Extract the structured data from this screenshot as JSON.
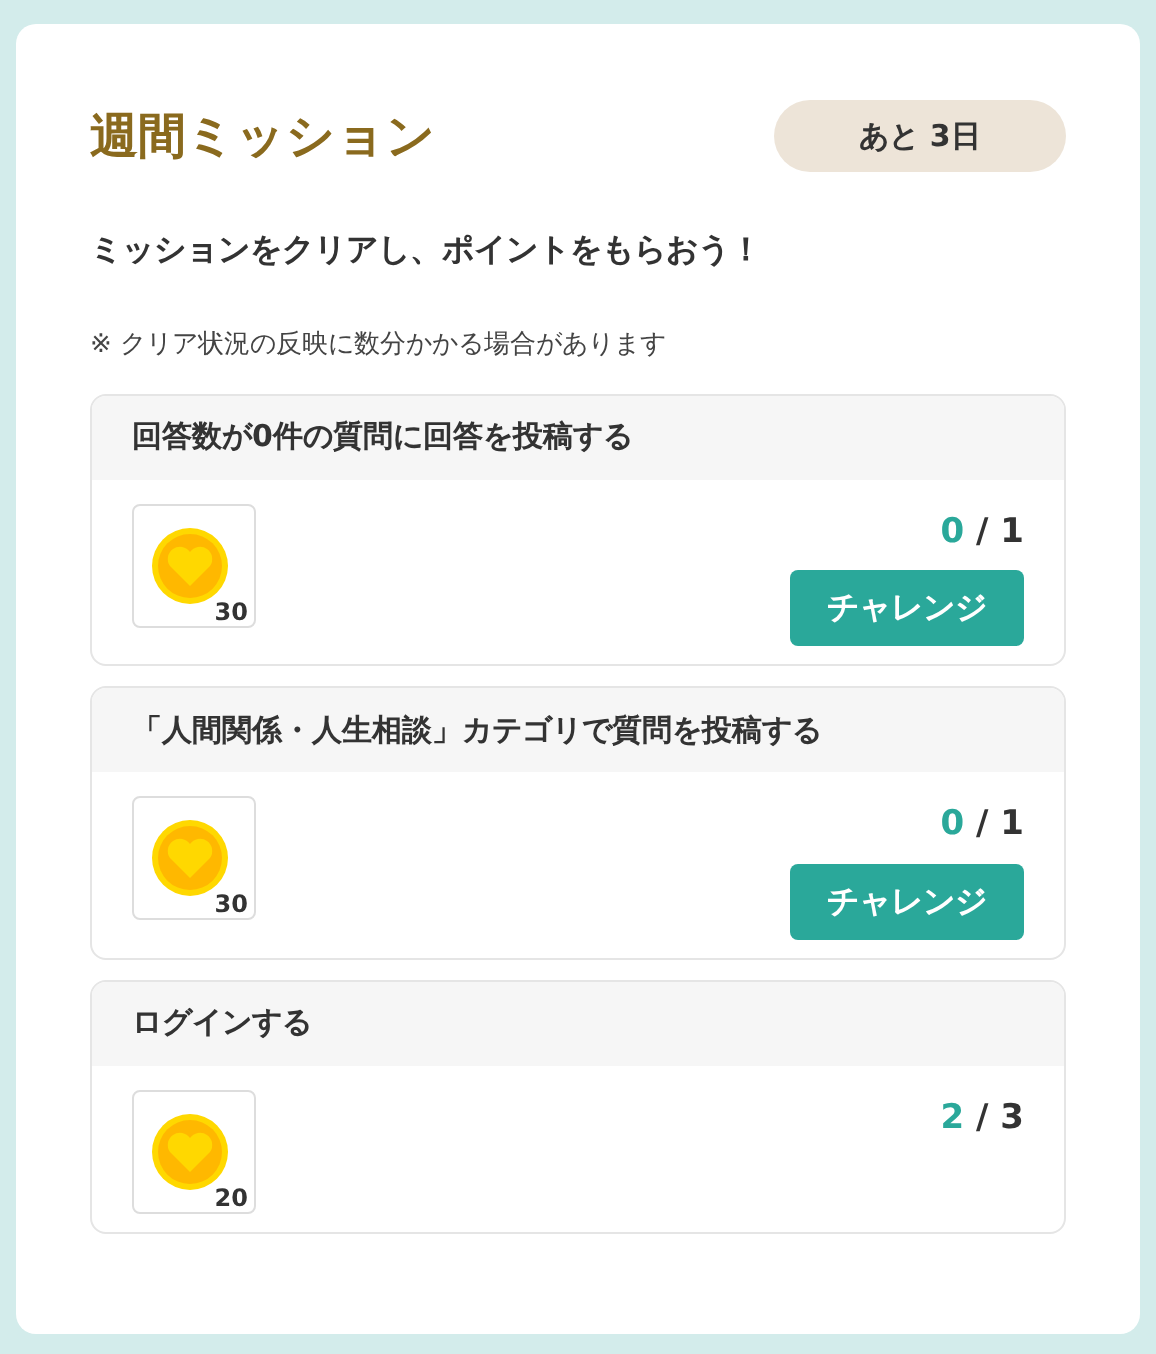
{
  "title": "週間ミッション",
  "remaining": "あと 3日",
  "subtitle": "ミッションをクリアし、ポイントをもらおう！",
  "note": "※ クリア状況の反映に数分かかる場合があります",
  "missions": [
    {
      "name": "回答数が0件の質問に回答を投稿する",
      "points": "30",
      "done": "0",
      "total": "/ 1",
      "button": "チャレンジ"
    },
    {
      "name": "「人間関係・人生相談」カテゴリで質問を投稿する",
      "points": "30",
      "done": "0",
      "total": "/ 1",
      "button": "チャレンジ"
    },
    {
      "name": "ログインする",
      "points": "20",
      "done": "2",
      "total": "/ 3"
    }
  ]
}
